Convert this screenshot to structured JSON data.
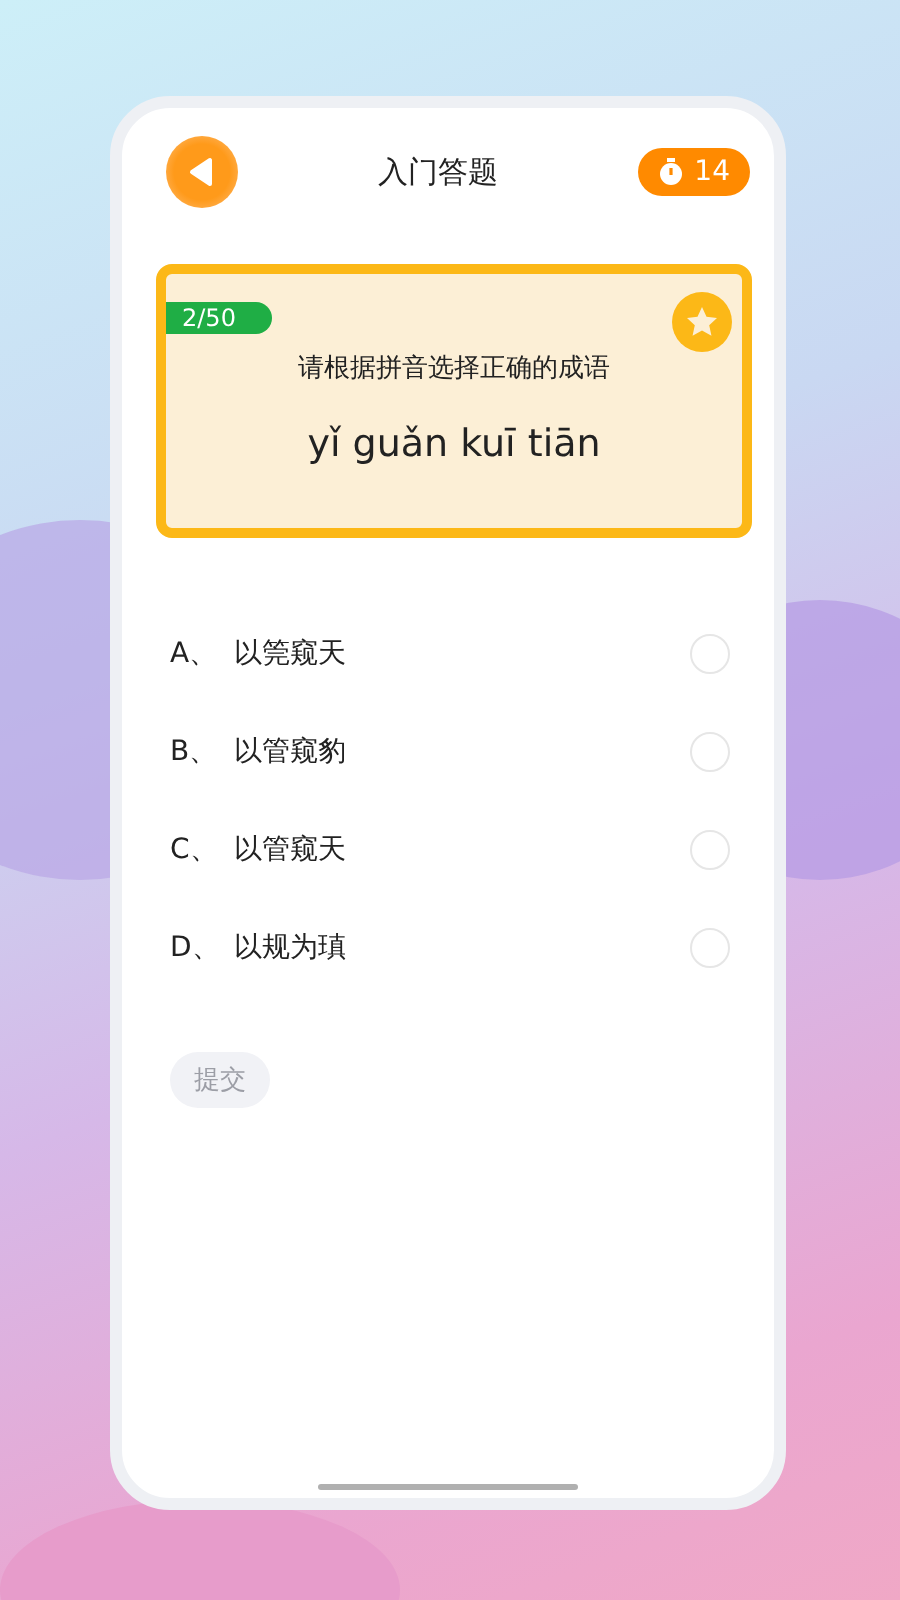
{
  "header": {
    "title": "入门答题",
    "timer": "14"
  },
  "question": {
    "progress": "2/50",
    "favorited": false,
    "prompt": "请根据拼音选择正确的成语",
    "pinyin": "yǐ guǎn kuī tiān"
  },
  "options": [
    {
      "letter": "A、",
      "text": "以筦窥天",
      "selected": false
    },
    {
      "letter": "B、",
      "text": "以管窥豹",
      "selected": false
    },
    {
      "letter": "C、",
      "text": "以管窥天",
      "selected": false
    },
    {
      "letter": "D、",
      "text": "以规为瑱",
      "selected": false
    }
  ],
  "submit": {
    "label": "提交",
    "disabled": true
  }
}
